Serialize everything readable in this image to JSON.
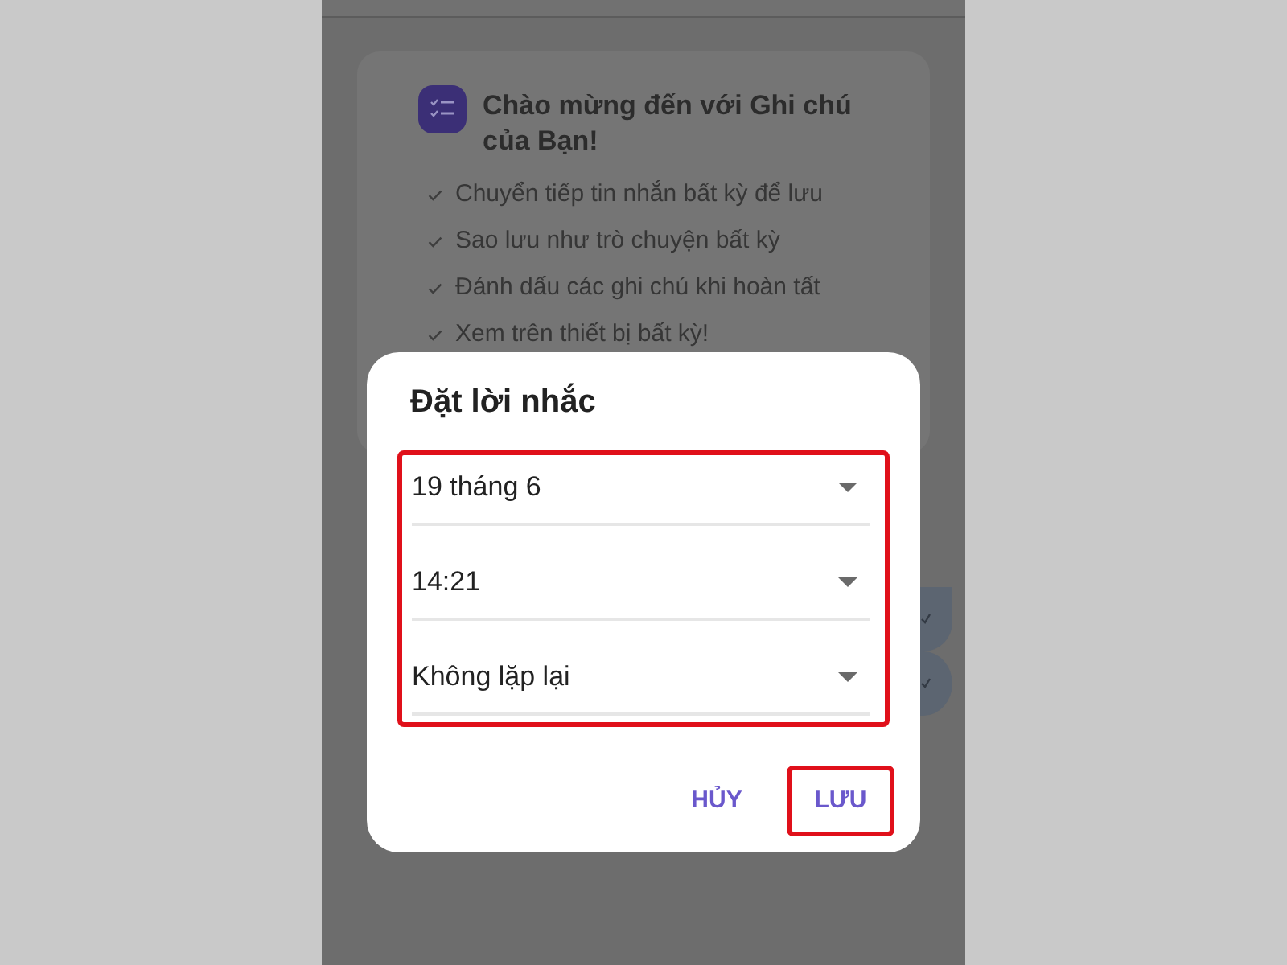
{
  "background": {
    "card": {
      "title": "Chào mừng đến với Ghi chú của Bạn!",
      "features": [
        "Chuyển tiếp tin nhắn bất kỳ để lưu",
        "Sao lưu như trò chuyện bất kỳ",
        "Đánh dấu các ghi chú khi hoàn tất",
        "Xem trên thiết bị bất kỳ!"
      ]
    }
  },
  "dialog": {
    "title": "Đặt lời nhắc",
    "fields_highlighted": true,
    "fields": [
      {
        "value": "19 tháng 6"
      },
      {
        "value": "14:21"
      },
      {
        "value": "Không lặp lại"
      }
    ],
    "buttons": [
      {
        "label": "HỦY",
        "highlighted": false
      },
      {
        "label": "LƯU",
        "highlighted": true
      }
    ]
  }
}
